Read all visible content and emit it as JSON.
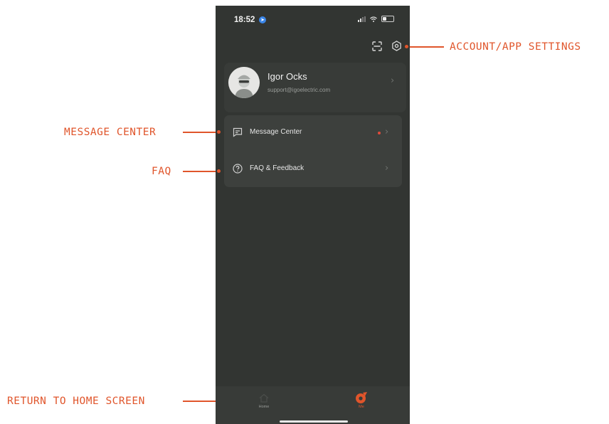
{
  "annotations": {
    "account_settings": "ACCOUNT/APP SETTINGS",
    "message_center": "MESSAGE CENTER",
    "faq": "FAQ",
    "return_home": "RETURN TO HOME SCREEN"
  },
  "status_bar": {
    "time": "18:52",
    "location_icon": "location-arrow-icon",
    "signal_icon": "signal-icon",
    "wifi_icon": "wifi-icon",
    "battery_icon": "battery-icon"
  },
  "header": {
    "scan_icon": "scan-icon",
    "settings_icon": "gear-icon"
  },
  "profile": {
    "name": "Igor Ocks",
    "email": "support@igoelectric.com"
  },
  "menu": {
    "items": [
      {
        "label": "Message Center",
        "icon": "message-icon",
        "has_unread": true
      },
      {
        "label": "FAQ & Feedback",
        "icon": "help-circle-icon",
        "has_unread": false
      }
    ]
  },
  "tab_bar": {
    "tabs": [
      {
        "label": "Home",
        "active": false,
        "icon": "home-icon"
      },
      {
        "label": "Me",
        "active": true,
        "icon": "me-icon"
      }
    ]
  },
  "colors": {
    "accent": "#e0552b",
    "app_background": "#323532",
    "card_background": "#3d403d",
    "unread_dot": "#e24b3b"
  }
}
